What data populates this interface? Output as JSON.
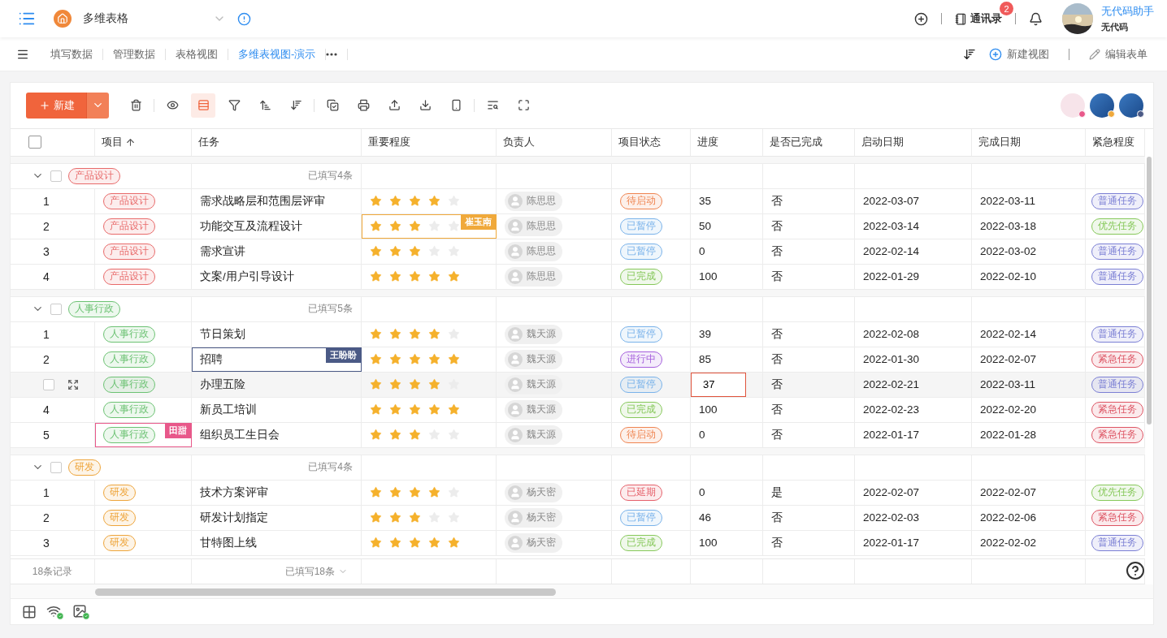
{
  "app": {
    "title": "多维表格"
  },
  "header": {
    "contacts_label": "通讯录",
    "contacts_badge": "2",
    "user_name": "无代码助手",
    "user_org": "无代码"
  },
  "tabs": [
    {
      "label": "填写数据",
      "selected": false
    },
    {
      "label": "管理数据",
      "selected": false
    },
    {
      "label": "表格视图",
      "selected": false
    },
    {
      "label": "多维表视图-演示",
      "selected": true
    }
  ],
  "view_actions": {
    "new_view": "新建视图",
    "edit_form": "编辑表单"
  },
  "toolbar": {
    "new_button": "新建",
    "tool_groups": [
      [
        {
          "kind": "delete",
          "selected": false
        }
      ],
      [
        {
          "kind": "view",
          "selected": false
        },
        {
          "kind": "row_height",
          "selected": true
        },
        {
          "kind": "filter",
          "selected": false
        },
        {
          "kind": "sort_asc",
          "selected": false
        },
        {
          "kind": "sort_desc",
          "selected": false
        }
      ],
      [
        {
          "kind": "copy",
          "selected": false
        },
        {
          "kind": "print",
          "selected": false
        },
        {
          "kind": "import",
          "selected": false
        },
        {
          "kind": "export",
          "selected": false
        },
        {
          "kind": "mobile",
          "selected": false
        }
      ],
      [
        {
          "kind": "find",
          "selected": false
        },
        {
          "kind": "fullscreen",
          "selected": false
        }
      ]
    ]
  },
  "online_users": [
    {
      "color": "#e8588a"
    },
    {
      "color": "#f0a93b"
    },
    {
      "color": "#4b5a86"
    }
  ],
  "table": {
    "all_checked": false,
    "columns": [
      {
        "label": "项目",
        "sorted": true
      },
      {
        "label": "任务",
        "sorted": false
      },
      {
        "label": "重要程度",
        "sorted": false
      },
      {
        "label": "负责人",
        "sorted": false
      },
      {
        "label": "项目状态",
        "sorted": false
      },
      {
        "label": "进度",
        "sorted": false
      },
      {
        "label": "是否已完成",
        "sorted": false
      },
      {
        "label": "启动日期",
        "sorted": false
      },
      {
        "label": "完成日期",
        "sorted": false
      },
      {
        "label": "紧急程度",
        "sorted": false
      }
    ],
    "groups": [
      {
        "label": "产品设计",
        "color": "#e86a6a",
        "expanded": true,
        "checked": false,
        "summary": "已填写4条",
        "rows": [
          {
            "index": "1",
            "project": "产品设计",
            "task": "需求战略层和范围层评审",
            "stars": 4,
            "owner": "陈思思",
            "status": {
              "label": "待启动",
              "color": "#ef8450"
            },
            "progress": "35",
            "done": "否",
            "start": "2022-03-07",
            "end": "2022-03-11",
            "urgency": {
              "label": "普通任务",
              "color": "#7b7fd4"
            },
            "hovered": false,
            "checked": false,
            "editing": false
          },
          {
            "index": "2",
            "project": "产品设计",
            "task": "功能交互及流程设计",
            "stars": 3,
            "owner": "陈思思",
            "status": {
              "label": "已暂停",
              "color": "#79b2ea"
            },
            "progress": "50",
            "done": "否",
            "start": "2022-03-14",
            "end": "2022-03-18",
            "urgency": {
              "label": "优先任务",
              "color": "#86c85a"
            },
            "hovered": false,
            "checked": false,
            "editing": false,
            "stars_collaborator": {
              "name": "崔玉南",
              "color": "#f0a93b"
            }
          },
          {
            "index": "3",
            "project": "产品设计",
            "task": "需求宣讲",
            "stars": 3,
            "owner": "陈思思",
            "status": {
              "label": "已暂停",
              "color": "#79b2ea"
            },
            "progress": "0",
            "done": "否",
            "start": "2022-02-14",
            "end": "2022-03-02",
            "urgency": {
              "label": "普通任务",
              "color": "#7b7fd4"
            },
            "hovered": false,
            "checked": false,
            "editing": false
          },
          {
            "index": "4",
            "project": "产品设计",
            "task": "文案/用户引导设计",
            "stars": 5,
            "owner": "陈思思",
            "status": {
              "label": "已完成",
              "color": "#86c85a"
            },
            "progress": "100",
            "done": "否",
            "start": "2022-01-29",
            "end": "2022-02-10",
            "urgency": {
              "label": "普通任务",
              "color": "#7b7fd4"
            },
            "hovered": false,
            "checked": false,
            "editing": false
          }
        ]
      },
      {
        "label": "人事行政",
        "color": "#6cc273",
        "expanded": true,
        "checked": false,
        "summary": "已填写5条",
        "rows": [
          {
            "index": "1",
            "project": "人事行政",
            "task": "节日策划",
            "stars": 4,
            "owner": "魏天源",
            "status": {
              "label": "已暂停",
              "color": "#79b2ea"
            },
            "progress": "39",
            "done": "否",
            "start": "2022-02-08",
            "end": "2022-02-14",
            "urgency": {
              "label": "普通任务",
              "color": "#7b7fd4"
            },
            "hovered": false,
            "checked": false,
            "editing": false
          },
          {
            "index": "2",
            "project": "人事行政",
            "task": "招聘",
            "stars": 5,
            "owner": "魏天源",
            "status": {
              "label": "进行中",
              "color": "#a55fdc"
            },
            "progress": "85",
            "done": "否",
            "start": "2022-01-30",
            "end": "2022-02-07",
            "urgency": {
              "label": "紧急任务",
              "color": "#dd5463"
            },
            "hovered": false,
            "checked": false,
            "editing": false,
            "task_collaborator": {
              "name": "王盼盼",
              "color": "#4b5a86"
            }
          },
          {
            "project": "人事行政",
            "task": "办理五险",
            "stars": 4,
            "owner": "魏天源",
            "status": {
              "label": "已暂停",
              "color": "#79b2ea"
            },
            "progress": "37",
            "done": "否",
            "start": "2022-02-21",
            "end": "2022-03-11",
            "urgency": {
              "label": "普通任务",
              "color": "#7b7fd4"
            },
            "hovered": true,
            "checked": false,
            "editing": true
          },
          {
            "index": "4",
            "project": "人事行政",
            "task": "新员工培训",
            "stars": 5,
            "owner": "魏天源",
            "status": {
              "label": "已完成",
              "color": "#86c85a"
            },
            "progress": "100",
            "done": "否",
            "start": "2022-02-23",
            "end": "2022-02-20",
            "urgency": {
              "label": "紧急任务",
              "color": "#dd5463"
            },
            "hovered": false,
            "checked": false,
            "editing": false
          },
          {
            "index": "5",
            "project": "人事行政",
            "task": "组织员工生日会",
            "stars": 3,
            "owner": "魏天源",
            "status": {
              "label": "待启动",
              "color": "#ef8450"
            },
            "progress": "0",
            "done": "否",
            "start": "2022-01-17",
            "end": "2022-01-28",
            "urgency": {
              "label": "紧急任务",
              "color": "#dd5463"
            },
            "hovered": false,
            "checked": false,
            "editing": false,
            "project_collaborator": {
              "name": "田甜",
              "color": "#e8588a"
            }
          }
        ]
      },
      {
        "label": "研发",
        "color": "#eea53c",
        "expanded": true,
        "checked": false,
        "summary": "已填写4条",
        "rows": [
          {
            "index": "1",
            "project": "研发",
            "task": "技术方案评审",
            "stars": 4,
            "owner": "杨天密",
            "status": {
              "label": "已延期",
              "color": "#e5606a"
            },
            "progress": "0",
            "done": "是",
            "start": "2022-02-07",
            "end": "2022-02-07",
            "urgency": {
              "label": "优先任务",
              "color": "#86c85a"
            },
            "hovered": false,
            "checked": false,
            "editing": false
          },
          {
            "index": "2",
            "project": "研发",
            "task": "研发计划指定",
            "stars": 3,
            "owner": "杨天密",
            "status": {
              "label": "已暂停",
              "color": "#79b2ea"
            },
            "progress": "46",
            "done": "否",
            "start": "2022-02-03",
            "end": "2022-02-06",
            "urgency": {
              "label": "紧急任务",
              "color": "#dd5463"
            },
            "hovered": false,
            "checked": false,
            "editing": false
          },
          {
            "index": "3",
            "project": "研发",
            "task": "甘特图上线",
            "stars": 5,
            "owner": "杨天密",
            "status": {
              "label": "已完成",
              "color": "#86c85a"
            },
            "progress": "100",
            "done": "否",
            "start": "2022-01-17",
            "end": "2022-02-02",
            "urgency": {
              "label": "普通任务",
              "color": "#7b7fd4"
            },
            "hovered": false,
            "checked": false,
            "editing": false
          }
        ]
      }
    ]
  },
  "footer": {
    "records": "18条记录",
    "filled": "已填写18条"
  }
}
